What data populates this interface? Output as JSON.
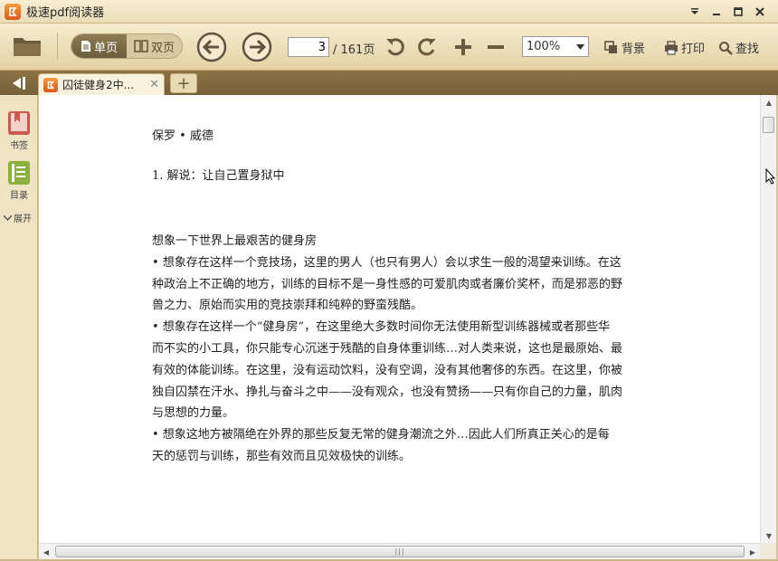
{
  "app": {
    "title": "极速pdf阅读器",
    "window_controls": [
      "menu-dropdown",
      "minimize",
      "maximize",
      "close"
    ]
  },
  "toolbar": {
    "view_single_label": "单页",
    "view_double_label": "双页",
    "view_mode_selected": "单页",
    "page_current": "3",
    "page_total": "/ 161页",
    "zoom_value": "100%",
    "background_label": "背景",
    "print_label": "打印",
    "find_label": "查找",
    "icons": [
      "open-folder-icon",
      "prev-page-icon",
      "next-page-icon",
      "rotate-left-icon",
      "rotate-right-icon",
      "zoom-in-icon",
      "zoom-out-icon"
    ]
  },
  "tabs": {
    "items": [
      {
        "label": "囚徒健身2中...",
        "active": true
      }
    ],
    "new_tab_label": "+"
  },
  "sidebar": {
    "bookmark_label": "书签",
    "toc_label": "目录",
    "expand_label": "展开"
  },
  "document": {
    "author": "保罗 • 威德",
    "section": "1. 解说：让自己置身狱中",
    "body_lines": [
      "想象一下世界上最艰苦的健身房",
      "• 想象存在这样一个竞技场，这里的男人（也只有男人）会以求生一般的渴望来训练。在这",
      "种政治上不正确的地方，训练的目标不是一身性感的可爱肌肉或者廉价奖杯，而是邪恶的野",
      "兽之力、原始而实用的竞技崇拜和纯粹的野蛮残酷。",
      "• 想象存在这样一个“健身房”，在这里绝大多数时间你无法使用新型训练器械或者那些华",
      "而不实的小工具，你只能专心沉迷于残酷的自身体重训练…对人类来说，这也是最原始、最",
      "有效的体能训练。在这里，没有运动饮料，没有空调，没有其他奢侈的东西。在这里，你被",
      "独自囚禁在汗水、挣扎与奋斗之中——没有观众，也没有赞扬——只有你自己的力量，肌肉",
      "与思想的力量。",
      "• 想象这地方被隔绝在外界的那些反复无常的健身潮流之外…因此人们所真正关心的是每",
      "天的惩罚与训练，那些有效而且见效极快的训练。"
    ]
  },
  "scrollbar": {
    "h_thumb_grip": "|||"
  },
  "colors": {
    "toolbar_bg": "#eadcb5",
    "tabbar_bg": "#7d663e",
    "accent_orange": "#e8742a",
    "sidebar_bg": "#efe3c4"
  }
}
